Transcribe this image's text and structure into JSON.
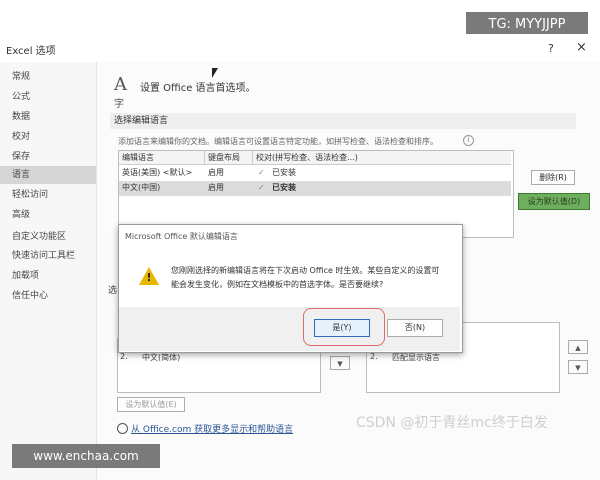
{
  "window": {
    "title": "Excel 选项",
    "help": "?",
    "close": "×"
  },
  "watermarks": {
    "tg": "TG: MYYJJPP",
    "csdn": "CSDN @初于青丝mc终于白发",
    "site": "www.enchaa.com"
  },
  "sidebar": {
    "items": [
      {
        "label": "常规",
        "selected": false
      },
      {
        "label": "公式",
        "selected": false
      },
      {
        "label": "数据",
        "selected": false
      },
      {
        "label": "校对",
        "selected": false
      },
      {
        "label": "保存",
        "selected": false
      },
      {
        "label": "语言",
        "selected": true
      },
      {
        "label": "轻松访问",
        "selected": false
      },
      {
        "label": "高级",
        "selected": false
      },
      {
        "label": "自定义功能区",
        "selected": false
      },
      {
        "label": "快速访问工具栏",
        "selected": false
      },
      {
        "label": "加载项",
        "selected": false
      },
      {
        "label": "信任中心",
        "selected": false
      }
    ]
  },
  "main": {
    "heading": "设置 Office 语言首选项。",
    "section_title": "选择编辑语言",
    "hint": "添加语言来编辑你的文档。编辑语言可设置语言特定功能，如拼写检查、语法检查和排序。",
    "table": {
      "headers": [
        "编辑语言",
        "键盘布局",
        "校对(拼写检查、语法检查...)"
      ],
      "rows": [
        {
          "lang": "英语(美国) <默认>",
          "kbd": "启用",
          "proof": "已安装"
        },
        {
          "lang": "中文(中国)",
          "kbd": "启用",
          "proof": "已安装"
        }
      ]
    },
    "remove_button": "删除(R)",
    "set_default_button": "设为默认值(D)",
    "lower_section_letter": "选",
    "left_pane": {
      "item_num": "2.",
      "item_label": "中文(简体)",
      "set_default": "设为默认值(E)"
    },
    "right_pane": {
      "item_num": "2.",
      "item_label": "匹配显示语言"
    },
    "link": "从 Office.com 获取更多显示和帮助语言"
  },
  "dialog": {
    "title": "Microsoft Office 默认编辑语言",
    "message_line1": "您刚刚选择的新编辑语言将在下次启动 Office 时生效。某些自定义的设置可",
    "message_line2": "能会发生变化，例如在文档模板中的首选字体。是否要继续?",
    "yes": "是(Y)",
    "no": "否(N)"
  }
}
